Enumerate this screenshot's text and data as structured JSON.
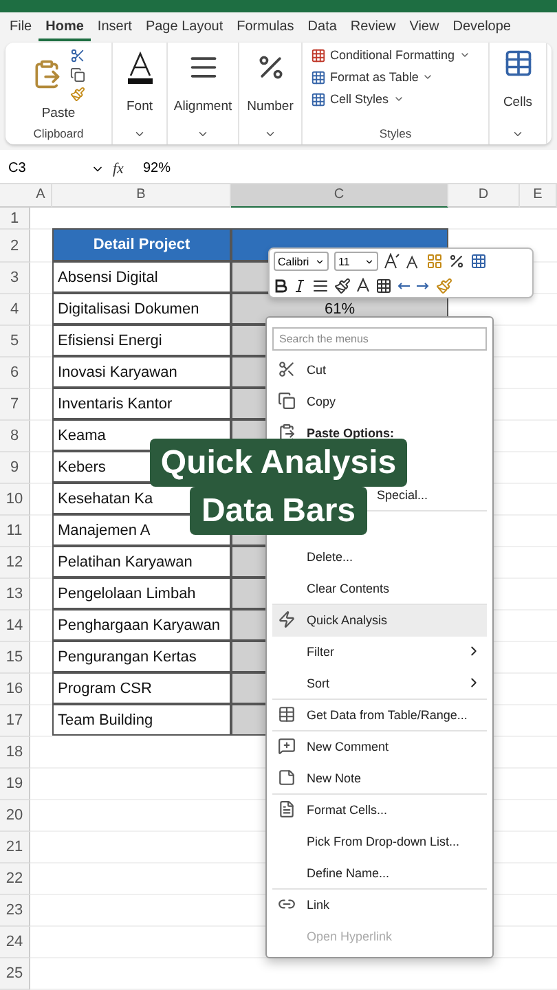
{
  "tabs": [
    {
      "label": "File",
      "selected": false
    },
    {
      "label": "Home",
      "selected": true
    },
    {
      "label": "Insert",
      "selected": false
    },
    {
      "label": "Page Layout",
      "selected": false
    },
    {
      "label": "Formulas",
      "selected": false
    },
    {
      "label": "Data",
      "selected": false
    },
    {
      "label": "Review",
      "selected": false
    },
    {
      "label": "View",
      "selected": false
    },
    {
      "label": "Develope",
      "selected": false
    }
  ],
  "ribbon": {
    "clipboard": {
      "paste": "Paste",
      "label": "Clipboard"
    },
    "big_buttons": [
      {
        "label": "Font"
      },
      {
        "label": "Alignment"
      },
      {
        "label": "Number"
      }
    ],
    "styles": {
      "items": [
        "Conditional Formatting",
        "Format as Table",
        "Cell Styles"
      ],
      "label": "Styles"
    },
    "cells": {
      "label": "Cells"
    }
  },
  "formula_bar": {
    "name_box": "C3",
    "fx": "fx",
    "value": "92%"
  },
  "columns": [
    {
      "label": "A",
      "selected": false
    },
    {
      "label": "B",
      "selected": false
    },
    {
      "label": "C",
      "selected": true
    },
    {
      "label": "D",
      "selected": false
    },
    {
      "label": "E",
      "selected": false
    }
  ],
  "rows": [
    {
      "number": "1",
      "kind": "empty"
    },
    {
      "number": "2",
      "kind": "header",
      "b": "Detail Project"
    },
    {
      "number": "3",
      "kind": "data",
      "b": "Absensi Digital",
      "selected": true
    },
    {
      "number": "4",
      "kind": "data",
      "b": "Digitalisasi Dokumen",
      "c": "61%",
      "selected": true
    },
    {
      "number": "5",
      "kind": "data",
      "b": "Efisiensi Energi",
      "selected": true
    },
    {
      "number": "6",
      "kind": "data",
      "b": "Inovasi Karyawan",
      "selected": true
    },
    {
      "number": "7",
      "kind": "data",
      "b": "Inventaris Kantor",
      "selected": true
    },
    {
      "number": "8",
      "kind": "data",
      "b": "Keama",
      "selected": true
    },
    {
      "number": "9",
      "kind": "data",
      "b": "Kebers"
    },
    {
      "number": "10",
      "kind": "data",
      "b": "Kesehatan Ka"
    },
    {
      "number": "11",
      "kind": "data",
      "b": "Manajemen A",
      "selected": true
    },
    {
      "number": "12",
      "kind": "data",
      "b": "Pelatihan Karyawan",
      "selected": true
    },
    {
      "number": "13",
      "kind": "data",
      "b": "Pengelolaan Limbah",
      "selected": true
    },
    {
      "number": "14",
      "kind": "data",
      "b": "Penghargaan Karyawan",
      "selected": true
    },
    {
      "number": "15",
      "kind": "data",
      "b": "Pengurangan Kertas",
      "selected": true
    },
    {
      "number": "16",
      "kind": "data",
      "b": "Program CSR",
      "selected": true
    },
    {
      "number": "17",
      "kind": "data",
      "b": "Team Building",
      "selected": true
    },
    {
      "number": "18",
      "kind": "empty"
    },
    {
      "number": "19",
      "kind": "empty"
    },
    {
      "number": "20",
      "kind": "empty"
    },
    {
      "number": "21",
      "kind": "empty"
    },
    {
      "number": "22",
      "kind": "empty"
    },
    {
      "number": "23",
      "kind": "empty"
    },
    {
      "number": "24",
      "kind": "empty"
    },
    {
      "number": "25",
      "kind": "empty"
    }
  ],
  "mini_toolbar": {
    "font": "Calibri",
    "size": "11"
  },
  "context_menu": {
    "search_placeholder": "Search the menus",
    "items": [
      {
        "label": "Cut",
        "kind": "item",
        "icon": true
      },
      {
        "label": "Copy",
        "kind": "item",
        "icon": true
      },
      {
        "label": "Paste Options:",
        "kind": "header",
        "icon": true
      },
      {
        "kind": "blank"
      },
      {
        "label": "Special...",
        "kind": "partial",
        "separator_after": true
      },
      {
        "kind": "blank"
      },
      {
        "label": "Delete...",
        "kind": "item"
      },
      {
        "label": "Clear Contents",
        "kind": "item",
        "separator_after": true
      },
      {
        "label": "Quick Analysis",
        "kind": "item",
        "icon": true,
        "selected": true
      },
      {
        "label": "Filter",
        "kind": "submenu",
        "selected": false
      },
      {
        "label": "Sort",
        "kind": "submenu",
        "separator_after": true
      },
      {
        "label": "Get Data from Table/Range...",
        "kind": "item",
        "icon": true,
        "separator_after": true
      },
      {
        "label": "New Comment",
        "kind": "item",
        "icon": true
      },
      {
        "label": "New Note",
        "kind": "item",
        "icon": true,
        "separator_after": true
      },
      {
        "label": "Format Cells...",
        "kind": "item",
        "icon": true
      },
      {
        "label": "Pick From Drop-down List...",
        "kind": "item"
      },
      {
        "label": "Define Name...",
        "kind": "item",
        "separator_after": true
      },
      {
        "label": "Link",
        "kind": "item",
        "icon": true
      },
      {
        "label": "Open Hyperlink",
        "kind": "item",
        "disabled": true
      }
    ]
  },
  "caption": [
    "Quick Analysis",
    "Data Bars"
  ]
}
